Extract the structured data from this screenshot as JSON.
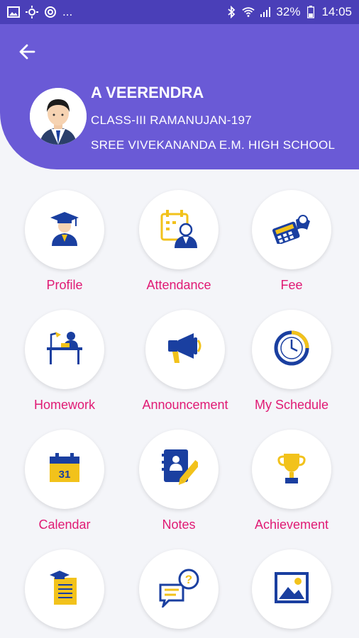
{
  "status_bar": {
    "icons_left": [
      "image-icon",
      "brightness-icon",
      "circle-app-icon"
    ],
    "dots": "...",
    "battery": "32%",
    "time": "14:05",
    "icons_right": [
      "bluetooth-icon",
      "wifi-icon",
      "signal-icon",
      "battery-icon"
    ]
  },
  "profile": {
    "name": "A VEERENDRA",
    "class": "CLASS-III RAMANUJAN-197",
    "school": "SREE VIVEKANANDA E.M. HIGH SCHOOL"
  },
  "menu": [
    {
      "label": "Profile",
      "icon": "graduate-icon"
    },
    {
      "label": "Attendance",
      "icon": "attendance-icon"
    },
    {
      "label": "Fee",
      "icon": "fee-calculator-icon"
    },
    {
      "label": "Homework",
      "icon": "homework-desk-icon"
    },
    {
      "label": "Announcement",
      "icon": "megaphone-icon"
    },
    {
      "label": "My Schedule",
      "icon": "clock-icon"
    },
    {
      "label": "Calendar",
      "icon": "calendar-icon"
    },
    {
      "label": "Notes",
      "icon": "notes-icon"
    },
    {
      "label": "Achievement",
      "icon": "trophy-icon"
    },
    {
      "label": "",
      "icon": "report-card-icon"
    },
    {
      "label": "",
      "icon": "chat-question-icon"
    },
    {
      "label": "",
      "icon": "gallery-icon"
    }
  ],
  "colors": {
    "header": "#6a5ad6",
    "status_bar": "#4a3fb8",
    "label": "#e01a74",
    "icon_blue": "#1a3fa0",
    "icon_yellow": "#f2c21b"
  }
}
